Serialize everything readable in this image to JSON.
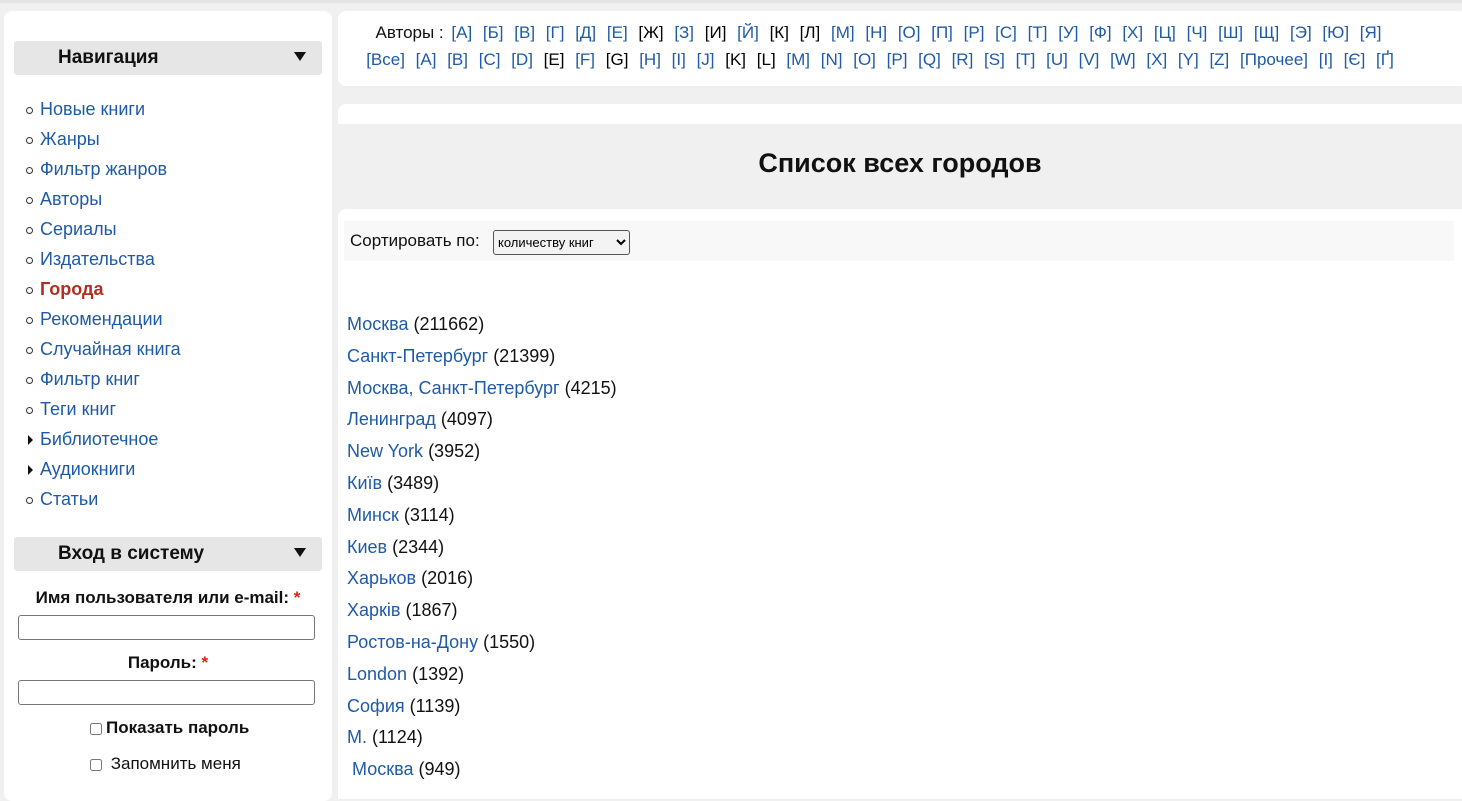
{
  "navigation": {
    "title": "Навигация",
    "items": [
      {
        "label": "Новые книги",
        "marker": "bullet"
      },
      {
        "label": "Жанры",
        "marker": "bullet"
      },
      {
        "label": "Фильтр жанров",
        "marker": "bullet"
      },
      {
        "label": "Авторы",
        "marker": "bullet"
      },
      {
        "label": "Сериалы",
        "marker": "bullet"
      },
      {
        "label": "Издательства",
        "marker": "bullet"
      },
      {
        "label": "Города",
        "marker": "bullet",
        "active": true
      },
      {
        "label": "Рекомендации",
        "marker": "bullet"
      },
      {
        "label": "Случайная книга",
        "marker": "bullet"
      },
      {
        "label": "Фильтр книг",
        "marker": "bullet"
      },
      {
        "label": "Теги книг",
        "marker": "bullet"
      },
      {
        "label": "Библиотечное",
        "marker": "arrow"
      },
      {
        "label": "Аудиокниги",
        "marker": "arrow"
      },
      {
        "label": "Статьи",
        "marker": "bullet"
      }
    ]
  },
  "login": {
    "title": "Вход в систему",
    "username_label": "Имя пользователя или e-mail:",
    "required_mark": "*",
    "password_label": "Пароль:",
    "show_password": "Показать пароль",
    "remember_me": "Запомнить меня"
  },
  "authors_bar": {
    "label": "Авторы :",
    "row1": [
      "[А]",
      "[Б]",
      "[В]",
      "[Г]",
      "[Д]",
      "[Е]",
      "[Ж]",
      "[З]",
      "[И]",
      "[Й]",
      "[К]",
      "[Л]",
      "[М]",
      "[Н]",
      "[О]",
      "[П]",
      "[Р]",
      "[С]",
      "[Т]",
      "[У]",
      "[Ф]",
      "[Х]",
      "[Ц]",
      "[Ч]",
      "[Ш]",
      "[Щ]",
      "[Э]",
      "[Ю]",
      "[Я]"
    ],
    "row2": [
      "[Все]",
      "[A]",
      "[B]",
      "[C]",
      "[D]",
      "[E]",
      "[F]",
      "[G]",
      "[H]",
      "[I]",
      "[J]",
      "[K]",
      "[L]",
      "[M]",
      "[N]",
      "[O]",
      "[P]",
      "[Q]",
      "[R]",
      "[S]",
      "[T]",
      "[U]",
      "[V]",
      "[W]",
      "[X]",
      "[Y]",
      "[Z]",
      "[Прочее]",
      "[І]",
      "[Є]",
      "[Ґ]"
    ]
  },
  "page_title": "Список всех городов",
  "sort": {
    "label": "Сортировать по:",
    "selected": "количеству книг"
  },
  "cities": [
    {
      "name": "Москва",
      "count": "(211662)"
    },
    {
      "name": "Санкт-Петербург",
      "count": "(21399)"
    },
    {
      "name": "Москва, Санкт-Петербург",
      "count": "(4215)"
    },
    {
      "name": "Ленинград",
      "count": "(4097)"
    },
    {
      "name": "New York",
      "count": "(3952)"
    },
    {
      "name": "Київ",
      "count": "(3489)"
    },
    {
      "name": "Минск",
      "count": "(3114)"
    },
    {
      "name": "Киев",
      "count": "(2344)"
    },
    {
      "name": "Харьков",
      "count": "(2016)"
    },
    {
      "name": "Харків",
      "count": "(1867)"
    },
    {
      "name": "Ростов-на-Дону",
      "count": "(1550)"
    },
    {
      "name": "London",
      "count": "(1392)"
    },
    {
      "name": "София",
      "count": "(1139)"
    },
    {
      "name": "М.",
      "count": "(1124)"
    },
    {
      "name": " Москва",
      "count": "(949)"
    }
  ]
}
